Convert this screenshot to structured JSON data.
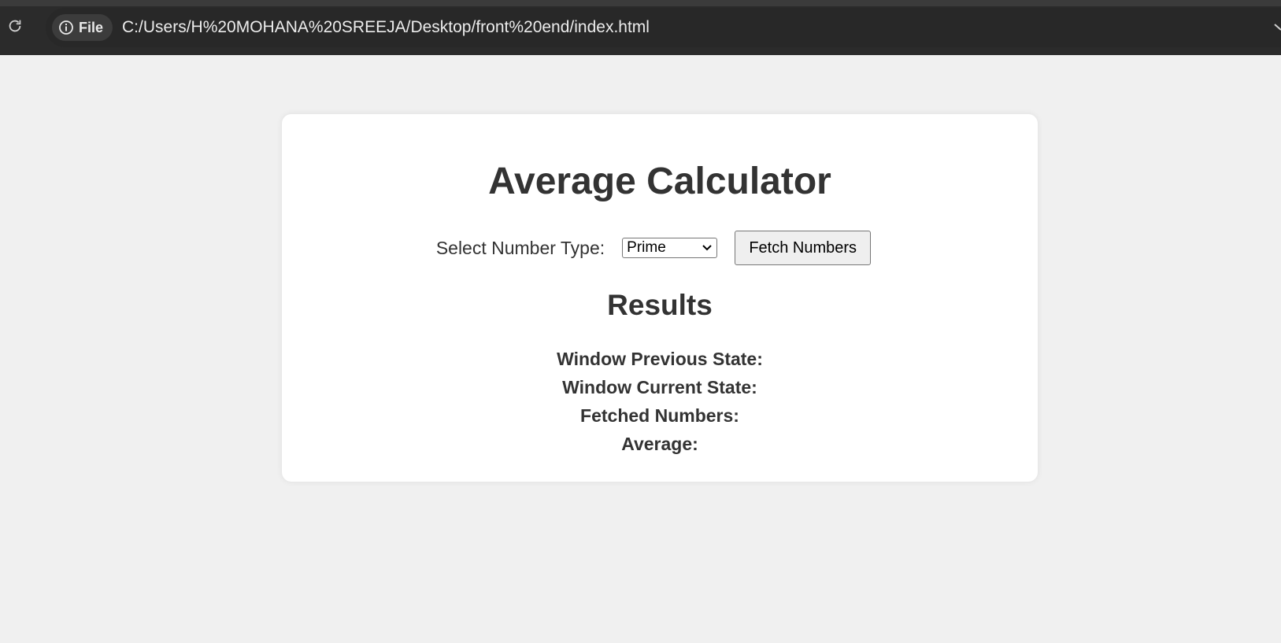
{
  "browser": {
    "site_chip_label": "File",
    "url": "C:/Users/H%20MOHANA%20SREEJA/Desktop/front%20end/index.html"
  },
  "page": {
    "title": "Average Calculator",
    "select_label": "Select Number Type:",
    "selected_type": "Prime",
    "fetch_button_label": "Fetch Numbers",
    "results_heading": "Results",
    "results": [
      {
        "label": "Window Previous State:"
      },
      {
        "label": "Window Current State:"
      },
      {
        "label": "Fetched Numbers:"
      },
      {
        "label": "Average:"
      }
    ]
  },
  "colors": {
    "page_background": "#f0f0f0",
    "card_background": "#ffffff",
    "heading_text": "#333333",
    "browser_toolbar": "#2b2b2b"
  },
  "icons": [
    "reload-icon",
    "info-icon",
    "chevron-down-icon"
  ]
}
